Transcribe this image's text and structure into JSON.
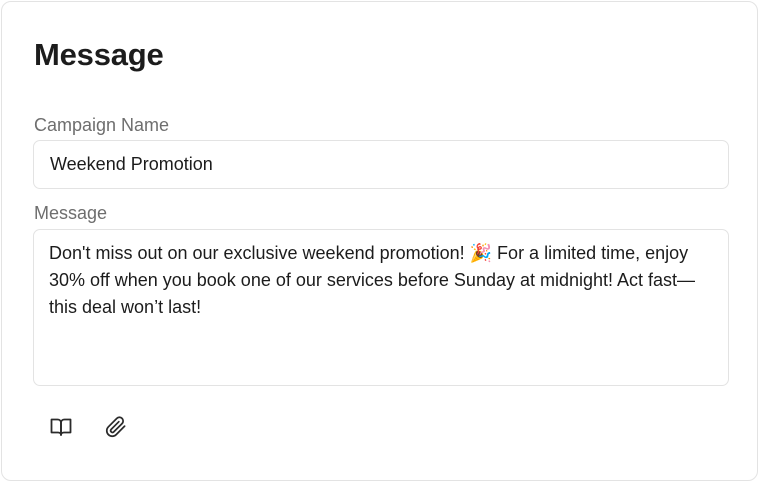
{
  "card": {
    "title": "Message"
  },
  "form": {
    "campaign_label": "Campaign Name",
    "campaign_value": "Weekend Promotion",
    "message_label": "Message",
    "message_value": "Don't miss out on our exclusive weekend promotion! 🎉 For a limited time, enjoy 30% off when you book one of our services before Sunday at midnight! Act fast—this deal won’t last!"
  },
  "toolbar": {
    "icons": [
      "book-icon",
      "paperclip-icon"
    ]
  },
  "colors": {
    "border": "#e3e3e3",
    "label": "#6e6e6e",
    "text": "#1c1c1c"
  }
}
